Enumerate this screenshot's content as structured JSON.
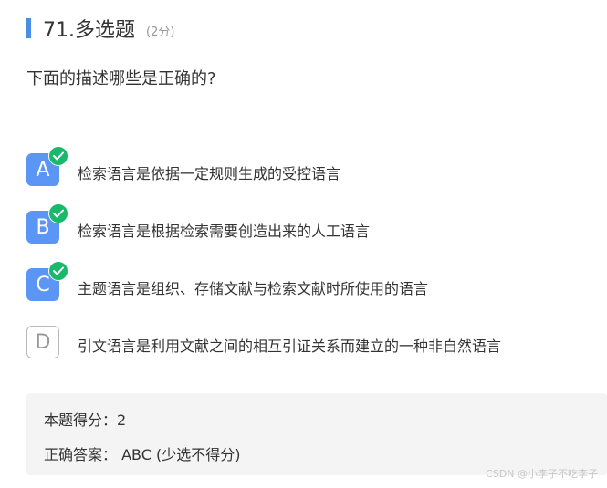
{
  "question": {
    "title": "71.多选题",
    "score": "(2分)",
    "stem": "下面的描述哪些是正确的?"
  },
  "options": [
    {
      "letter": "A",
      "text": "检索语言是依据一定规则生成的受控语言",
      "selected": true
    },
    {
      "letter": "B",
      "text": "检索语言是根据检索需要创造出来的人工语言",
      "selected": true
    },
    {
      "letter": "C",
      "text": "主题语言是组织、存储文献与检索文献时所使用的语言",
      "selected": true
    },
    {
      "letter": "D",
      "text": "引文语言是利用文献之间的相互引证关系而建立的一种非自然语言",
      "selected": false
    }
  ],
  "result": {
    "score_line": "本题得分：2",
    "answer_label": "正确答案：",
    "answer_value": "ABC (少选不得分)"
  },
  "watermark": "CSDN @小李子不吃李子",
  "colors": {
    "accent": "#4a90e2",
    "selected_option": "#5b95f5",
    "check": "#19b86b",
    "answer_bg": "#f4f4f4"
  },
  "icons": {
    "check": "check-circle-icon"
  }
}
